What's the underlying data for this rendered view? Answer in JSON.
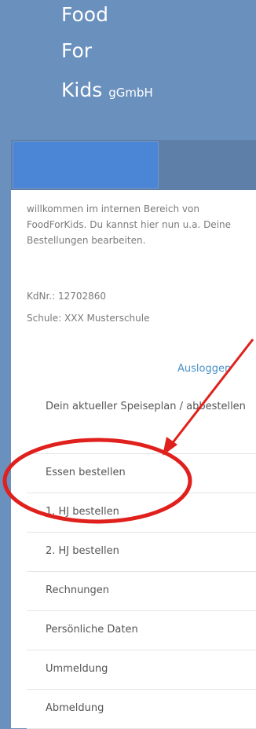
{
  "header": {
    "brand_line1": "Food",
    "brand_line2": "For",
    "brand_line3_main": "Kids",
    "brand_line3_suffix": "gGmbH"
  },
  "intro": {
    "text": "willkommen im internen Bereich von FoodForKids. Du kannst hier nun u.a. Deine Bestellungen bearbeiten.",
    "customer_number": "KdNr.: 12702860",
    "school": "Schule: XXX Musterschule",
    "logout_label": "Ausloggen"
  },
  "menu": {
    "items": [
      {
        "label": "Dein aktueller Speiseplan / abbestellen"
      },
      {
        "label": "Essen bestellen"
      },
      {
        "label": "1. HJ bestellen"
      },
      {
        "label": "2. HJ bestellen"
      },
      {
        "label": "Rechnungen"
      },
      {
        "label": "Persönliche Daten"
      },
      {
        "label": "Ummeldung"
      },
      {
        "label": "Abmeldung"
      }
    ]
  },
  "colors": {
    "header_bg": "#6a90bd",
    "nav_bg": "#5d7fa8",
    "nav_active": "#4a85d6",
    "link": "#4a90c8",
    "annotation": "#e0201c"
  },
  "annotation": {
    "shape": "ellipse",
    "arrow": true,
    "highlights": [
      "1. HJ bestellen",
      "2. HJ bestellen"
    ]
  }
}
